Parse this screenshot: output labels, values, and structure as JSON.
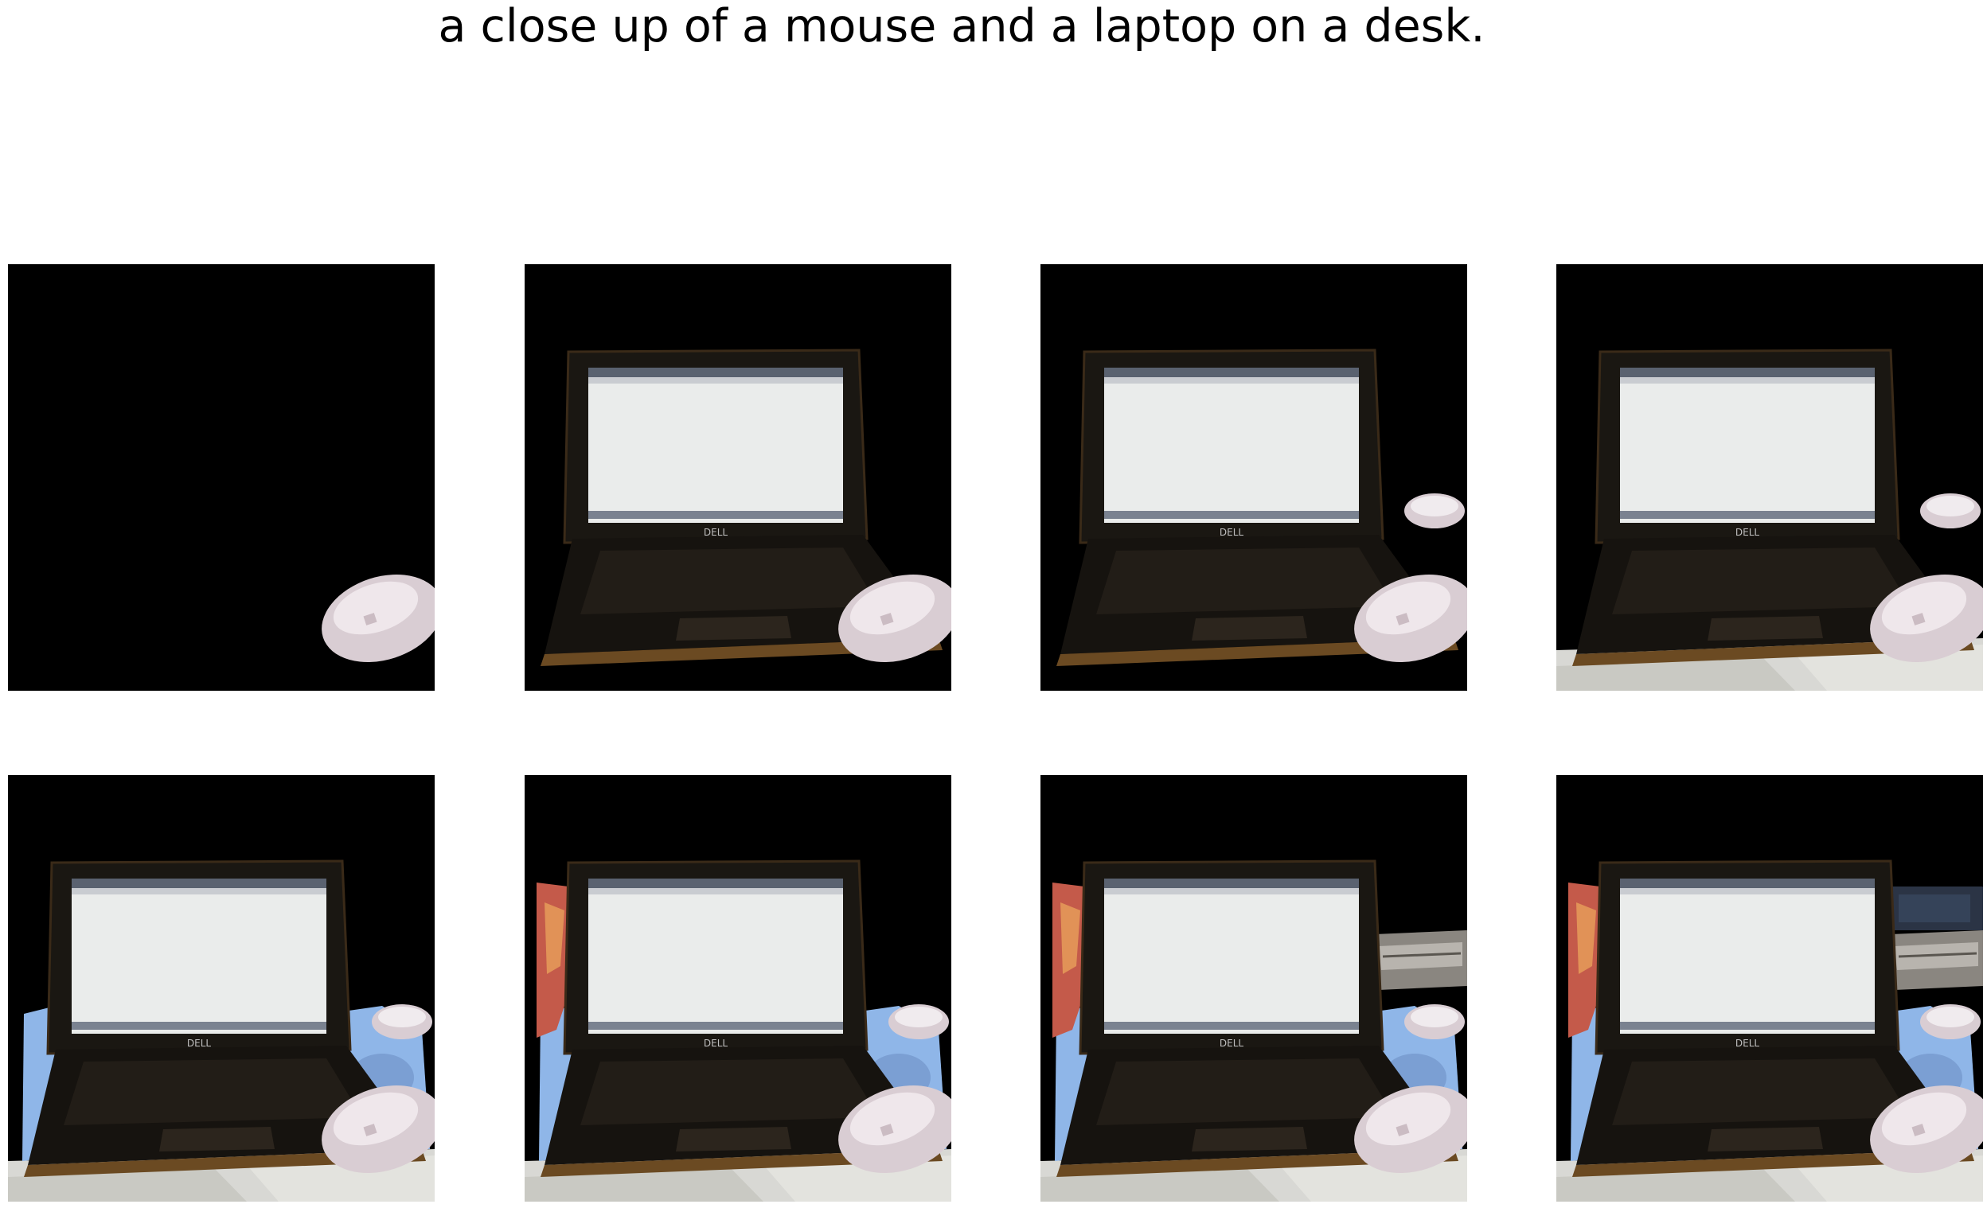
{
  "figure": {
    "caption": "a close up of a mouse and a laptop on a desk.",
    "panel_background": "#000000",
    "panels": [
      {
        "index": 1,
        "layers": [
          "mouse-front"
        ]
      },
      {
        "index": 2,
        "layers": [
          "laptop",
          "mouse-front"
        ]
      },
      {
        "index": 3,
        "layers": [
          "laptop",
          "mouse-front",
          "mouse-back"
        ]
      },
      {
        "index": 4,
        "layers": [
          "laptop",
          "mouse-front",
          "mouse-back",
          "desk-strip"
        ]
      },
      {
        "index": 5,
        "layers": [
          "laptop",
          "mouse-front",
          "mouse-back",
          "desk-strip",
          "blue-cloth"
        ]
      },
      {
        "index": 6,
        "layers": [
          "laptop",
          "mouse-front",
          "mouse-back",
          "desk-strip",
          "blue-cloth",
          "red-object"
        ]
      },
      {
        "index": 7,
        "layers": [
          "laptop",
          "mouse-front",
          "mouse-back",
          "desk-strip",
          "blue-cloth",
          "red-object",
          "keyboard-tray"
        ]
      },
      {
        "index": 8,
        "layers": [
          "laptop",
          "mouse-front",
          "mouse-back",
          "desk-strip",
          "blue-cloth",
          "red-object",
          "keyboard-tray",
          "dark-backdrop"
        ]
      }
    ],
    "laptop_logo": "DELL",
    "colors": {
      "laptop_body": "#1a1712",
      "screen": "#eaeceb",
      "mouse": "#d9cdd3",
      "desk": "#d8d8d4",
      "cloth": "#8fb6e8",
      "red_object": "#c45a4a"
    }
  }
}
